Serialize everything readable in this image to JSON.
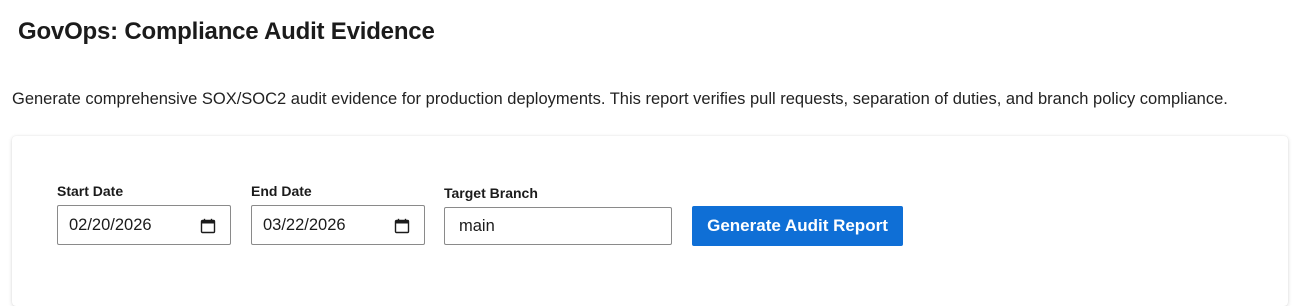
{
  "page": {
    "title": "GovOps: Compliance Audit Evidence",
    "description": "Generate comprehensive SOX/SOC2 audit evidence for production deployments. This report verifies pull requests, separation of duties, and branch policy compliance."
  },
  "form": {
    "start_date": {
      "label": "Start Date",
      "value": "02/20/2026"
    },
    "end_date": {
      "label": "End Date",
      "value": "03/22/2026"
    },
    "target_branch": {
      "label": "Target Branch",
      "value": "main"
    },
    "submit_label": "Generate Audit Report"
  },
  "icons": {
    "date_picker": "calendar-icon"
  },
  "colors": {
    "primary": "#0f6fd6",
    "input_border": "#8a8a8a"
  }
}
